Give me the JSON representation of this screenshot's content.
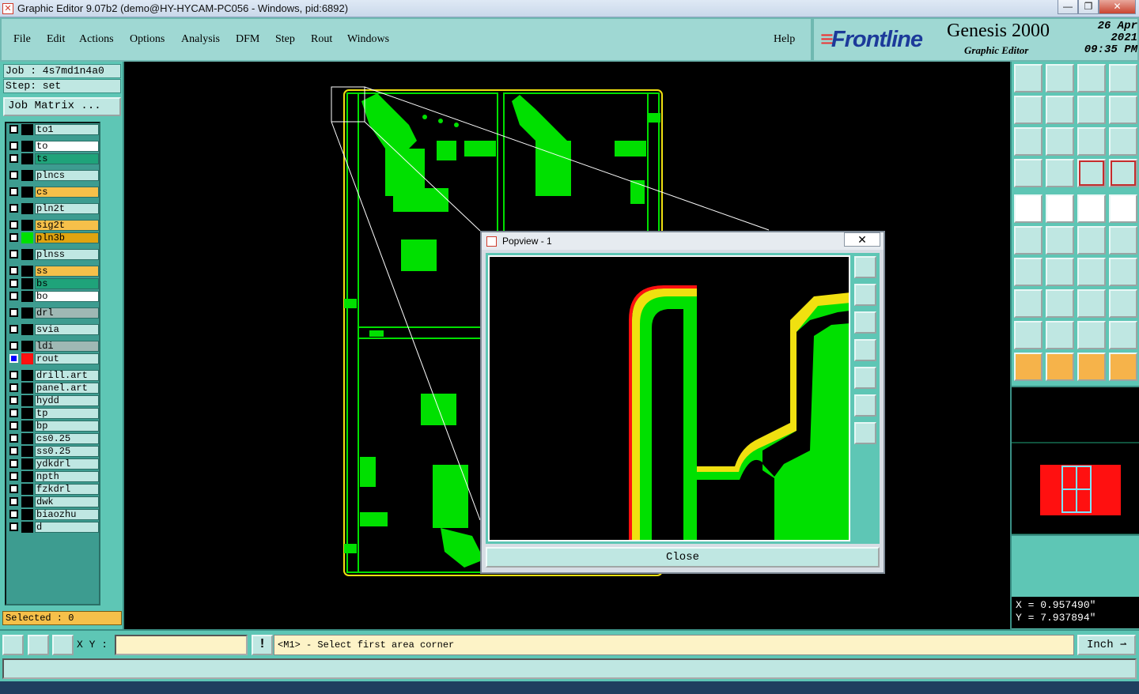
{
  "window": {
    "title": "Graphic Editor 9.07b2 (demo@HY-HYCAM-PC056 - Windows, pid:6892)"
  },
  "menu": {
    "items": [
      {
        "label": "File",
        "key": "F"
      },
      {
        "label": "Edit",
        "key": "E"
      },
      {
        "label": "Actions",
        "key": "A"
      },
      {
        "label": "Options",
        "key": "O"
      },
      {
        "label": "Analysis",
        "key": "A"
      },
      {
        "label": "DFM",
        "key": "D"
      },
      {
        "label": "Step",
        "key": "S"
      },
      {
        "label": "Rout",
        "key": "R"
      },
      {
        "label": "Windows",
        "key": "W"
      }
    ],
    "help": "Help"
  },
  "brand": {
    "logo": "Frontline",
    "product": "Genesis 2000",
    "subtitle": "Graphic Editor",
    "date": "26 Apr 2021",
    "time": "09:35 PM"
  },
  "job": {
    "job_label": "Job : 4s7md1n4a0",
    "step_label": "Step: set",
    "matrix_button": "Job Matrix ..."
  },
  "layers": [
    {
      "name": "to1",
      "color": "#bfe7e2",
      "swatch": "#000",
      "checked": false
    },
    {
      "name": "to",
      "color": "#ffffff",
      "swatch": "#000",
      "checked": false
    },
    {
      "name": "ts",
      "color": "#1fa37a",
      "swatch": "#000",
      "checked": false
    },
    {
      "name": "plncs",
      "color": "#bfe7e2",
      "swatch": "#000",
      "checked": false
    },
    {
      "name": "cs",
      "color": "#f6c04a",
      "swatch": "#000",
      "checked": false
    },
    {
      "name": "pln2t",
      "color": "#bfe7e2",
      "swatch": "#000",
      "checked": false
    },
    {
      "name": "sig2t",
      "color": "#f6c04a",
      "swatch": "#000",
      "checked": false
    },
    {
      "name": "pln3b",
      "color": "#e0a410",
      "swatch": "#00e000",
      "checked": false
    },
    {
      "name": "plnss",
      "color": "#bfe7e2",
      "swatch": "#000",
      "checked": false
    },
    {
      "name": "ss",
      "color": "#f6c04a",
      "swatch": "#000",
      "checked": false
    },
    {
      "name": "bs",
      "color": "#1fa37a",
      "swatch": "#000",
      "checked": false
    },
    {
      "name": "bo",
      "color": "#ffffff",
      "swatch": "#000",
      "checked": false
    },
    {
      "name": "drl",
      "color": "#9fb8b4",
      "swatch": "#000",
      "checked": false
    },
    {
      "name": "svia",
      "color": "#bfe7e2",
      "swatch": "#000",
      "checked": false
    },
    {
      "name": "ldi",
      "color": "#9fb8b4",
      "swatch": "#000",
      "checked": false
    },
    {
      "name": "rout",
      "color": "#bfe7e2",
      "swatch": "#ff1010",
      "checked": true
    },
    {
      "name": "drill.art",
      "color": "#bfe7e2",
      "swatch": "#000",
      "checked": false
    },
    {
      "name": "panel.art",
      "color": "#bfe7e2",
      "swatch": "#000",
      "checked": false
    },
    {
      "name": "hydd",
      "color": "#bfe7e2",
      "swatch": "#000",
      "checked": false
    },
    {
      "name": "tp",
      "color": "#bfe7e2",
      "swatch": "#000",
      "checked": false
    },
    {
      "name": "bp",
      "color": "#bfe7e2",
      "swatch": "#000",
      "checked": false
    },
    {
      "name": "cs0.25",
      "color": "#bfe7e2",
      "swatch": "#000",
      "checked": false
    },
    {
      "name": "ss0.25",
      "color": "#bfe7e2",
      "swatch": "#000",
      "checked": false
    },
    {
      "name": "ydkdrl",
      "color": "#bfe7e2",
      "swatch": "#000",
      "checked": false
    },
    {
      "name": "npth",
      "color": "#bfe7e2",
      "swatch": "#000",
      "checked": false
    },
    {
      "name": "fzkdrl",
      "color": "#bfe7e2",
      "swatch": "#000",
      "checked": false
    },
    {
      "name": "dwk",
      "color": "#bfe7e2",
      "swatch": "#000",
      "checked": false
    },
    {
      "name": "biaozhu",
      "color": "#bfe7e2",
      "swatch": "#000",
      "checked": false
    },
    {
      "name": "d",
      "color": "#bfe7e2",
      "swatch": "#000",
      "checked": false
    }
  ],
  "selected": "Selected : 0",
  "popview": {
    "title": "Popview - 1",
    "close_x": "✕",
    "close_button": "Close"
  },
  "coords": {
    "x": "X = 0.957490\"",
    "y": "Y = 7.937894\""
  },
  "status": {
    "xy_label": "X Y :",
    "xy_value": "",
    "message": "<M1> - Select first area corner",
    "unit": "Inch"
  },
  "colors": {
    "panel": "#5ec6b5",
    "menubar": "#9fd8d3",
    "copper": "#00e000",
    "rout": "#ff1010",
    "highlight": "#f0e010"
  },
  "tool_icons": [
    "clear-screen-icon",
    "home-icon",
    "house-icon",
    "window-icon",
    "pan-left-icon",
    "pan-right-icon",
    "zoom-home-icon",
    "zoom-s-icon",
    "fit-icon",
    "fit-screen-icon",
    "scale-1-2-icon",
    "help-icon",
    "snap-icon",
    "grid-icon",
    "layer-display-icon",
    "layer-select-icon",
    "feature-info-icon",
    "measure-icon",
    "ruler-icon",
    "pad-icon",
    "connect-icon",
    "cross-icon",
    "line-icon",
    "dot-line-icon",
    "angle-icon",
    "diagonal-icon",
    "rotate-icon",
    "mirror-icon",
    "pin-icon",
    "minus-icon",
    "center-icon",
    "group-icon",
    "triangle-edit-icon",
    "triangle-up-icon",
    "triangle-arrow-icon",
    "triangle-line-icon",
    "pointer-icon",
    "select-pointer-icon",
    "pointer-circle-icon",
    "move-icon"
  ]
}
